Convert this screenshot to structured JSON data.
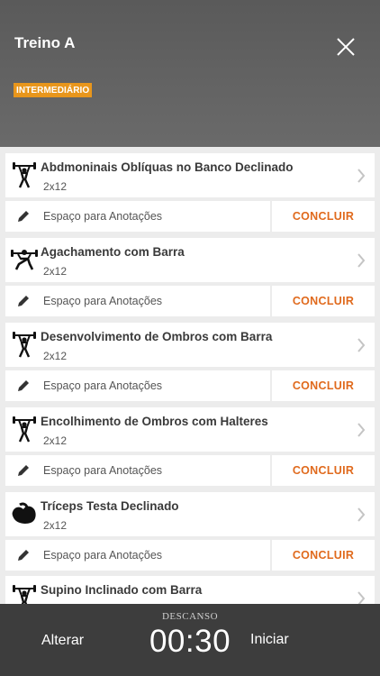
{
  "header": {
    "title": "Treino A",
    "level_badge": "INTERMEDIÁRIO",
    "badge_color": "#e8961c",
    "close_icon": "close-icon"
  },
  "exercises": [
    {
      "name": "Abdmoninais Oblíquas no Banco Declinado",
      "sets": "2x12",
      "note_placeholder": "Espaço para Anotações",
      "action": "CONCLUIR",
      "icon": "weightlifter-icon"
    },
    {
      "name": "Agachamento com Barra",
      "sets": "2x12",
      "note_placeholder": "Espaço para Anotações",
      "action": "CONCLUIR",
      "icon": "squat-icon"
    },
    {
      "name": "Desenvolvimento de Ombros com Barra",
      "sets": "2x12",
      "note_placeholder": "Espaço para Anotações",
      "action": "CONCLUIR",
      "icon": "weightlifter-icon"
    },
    {
      "name": "Encolhimento de Ombros com Halteres",
      "sets": "2x12",
      "note_placeholder": "Espaço para Anotações",
      "action": "CONCLUIR",
      "icon": "weightlifter-icon"
    },
    {
      "name": "Tríceps Testa Declinado",
      "sets": "2x12",
      "note_placeholder": "Espaço para Anotações",
      "action": "CONCLUIR",
      "icon": "bicep-icon"
    },
    {
      "name": "Supino Inclinado com Barra",
      "sets": "",
      "note_placeholder": "",
      "action": "",
      "icon": "weightlifter-icon"
    }
  ],
  "footer": {
    "left_button": "Alterar",
    "rest_label": "DESCANSO",
    "timer": "00:30",
    "right_button": "Iniciar"
  },
  "colors": {
    "accent": "#e06a1d",
    "header_bg": "#5f5f5f",
    "footer_bg": "#3d3d3d"
  }
}
